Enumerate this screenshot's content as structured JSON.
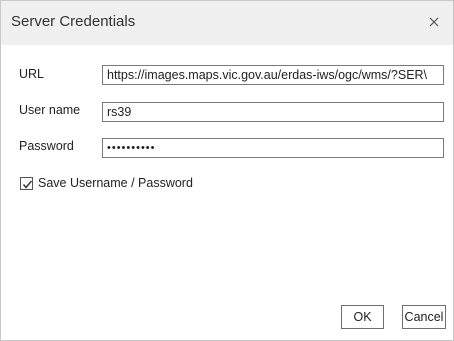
{
  "dialog": {
    "title": "Server Credentials",
    "close_icon": "close-icon"
  },
  "fields": {
    "url": {
      "label": "URL",
      "value": "https://images.maps.vic.gov.au/erdas-iws/ogc/wms/?SER\\"
    },
    "username": {
      "label": "User name",
      "value": "rs39"
    },
    "password": {
      "label": "Password",
      "value": "••••••••••"
    }
  },
  "save_credentials": {
    "label": "Save Username / Password",
    "checked": true
  },
  "buttons": {
    "ok": "OK",
    "cancel": "Cancel"
  }
}
